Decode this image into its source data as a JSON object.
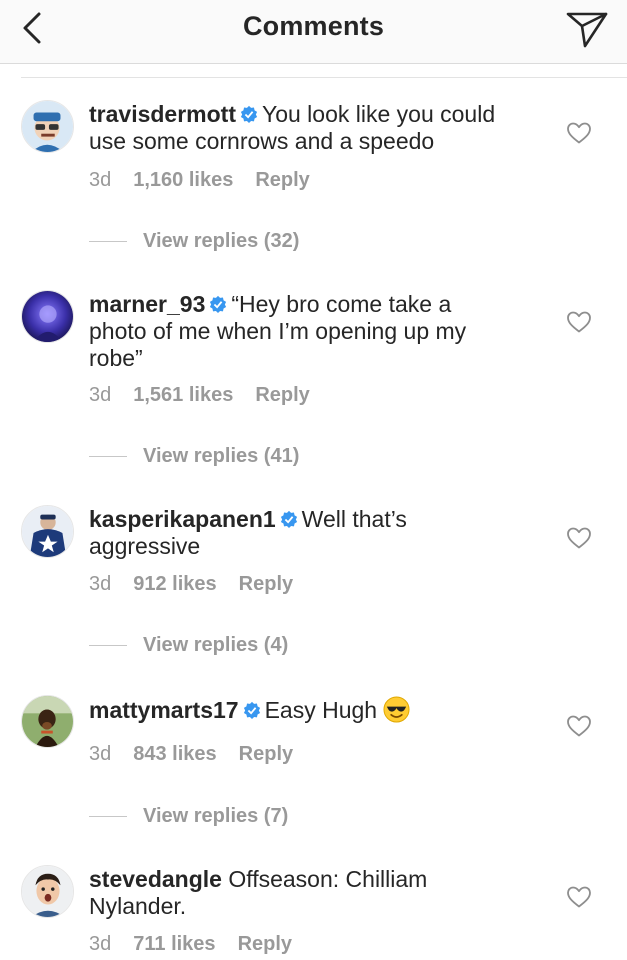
{
  "header": {
    "title": "Comments"
  },
  "comments": [
    {
      "username": "travisdermott",
      "verified": true,
      "text_lines": [
        "You look like you could",
        "use some cornrows and a speedo"
      ],
      "time": "3d",
      "likes": "1,160 likes",
      "reply_label": "Reply",
      "view_replies": "View replies (32)"
    },
    {
      "username": "marner_93",
      "verified": true,
      "text_lines": [
        "“Hey bro come take a",
        "photo of me when I’m opening up my",
        "robe”"
      ],
      "time": "3d",
      "likes": "1,561 likes",
      "reply_label": "Reply",
      "view_replies": "View replies (41)"
    },
    {
      "username": "kasperikapanen1",
      "verified": true,
      "text_lines": [
        "Well that’s",
        "aggressive"
      ],
      "time": "3d",
      "likes": "912 likes",
      "reply_label": "Reply",
      "view_replies": "View replies (4)"
    },
    {
      "username": "mattymarts17",
      "verified": true,
      "text_lines": [
        "Easy Hugh"
      ],
      "emoji": "sunglasses-emoji",
      "time": "3d",
      "likes": "843 likes",
      "reply_label": "Reply",
      "view_replies": "View replies (7)"
    },
    {
      "username": "stevedangle",
      "verified": false,
      "text_lines": [
        "Offseason: Chilliam",
        "Nylander."
      ],
      "time": "3d",
      "likes": "711 likes",
      "reply_label": "Reply"
    }
  ],
  "icons": {
    "back": "chevron-left-icon",
    "send": "paper-plane-icon",
    "like": "heart-outline-icon",
    "verified": "verified-badge-icon"
  },
  "colors": {
    "verified_badge": "#3897f0",
    "meta_text": "#999999",
    "primary_text": "#262626",
    "header_bg": "#fafafa"
  }
}
